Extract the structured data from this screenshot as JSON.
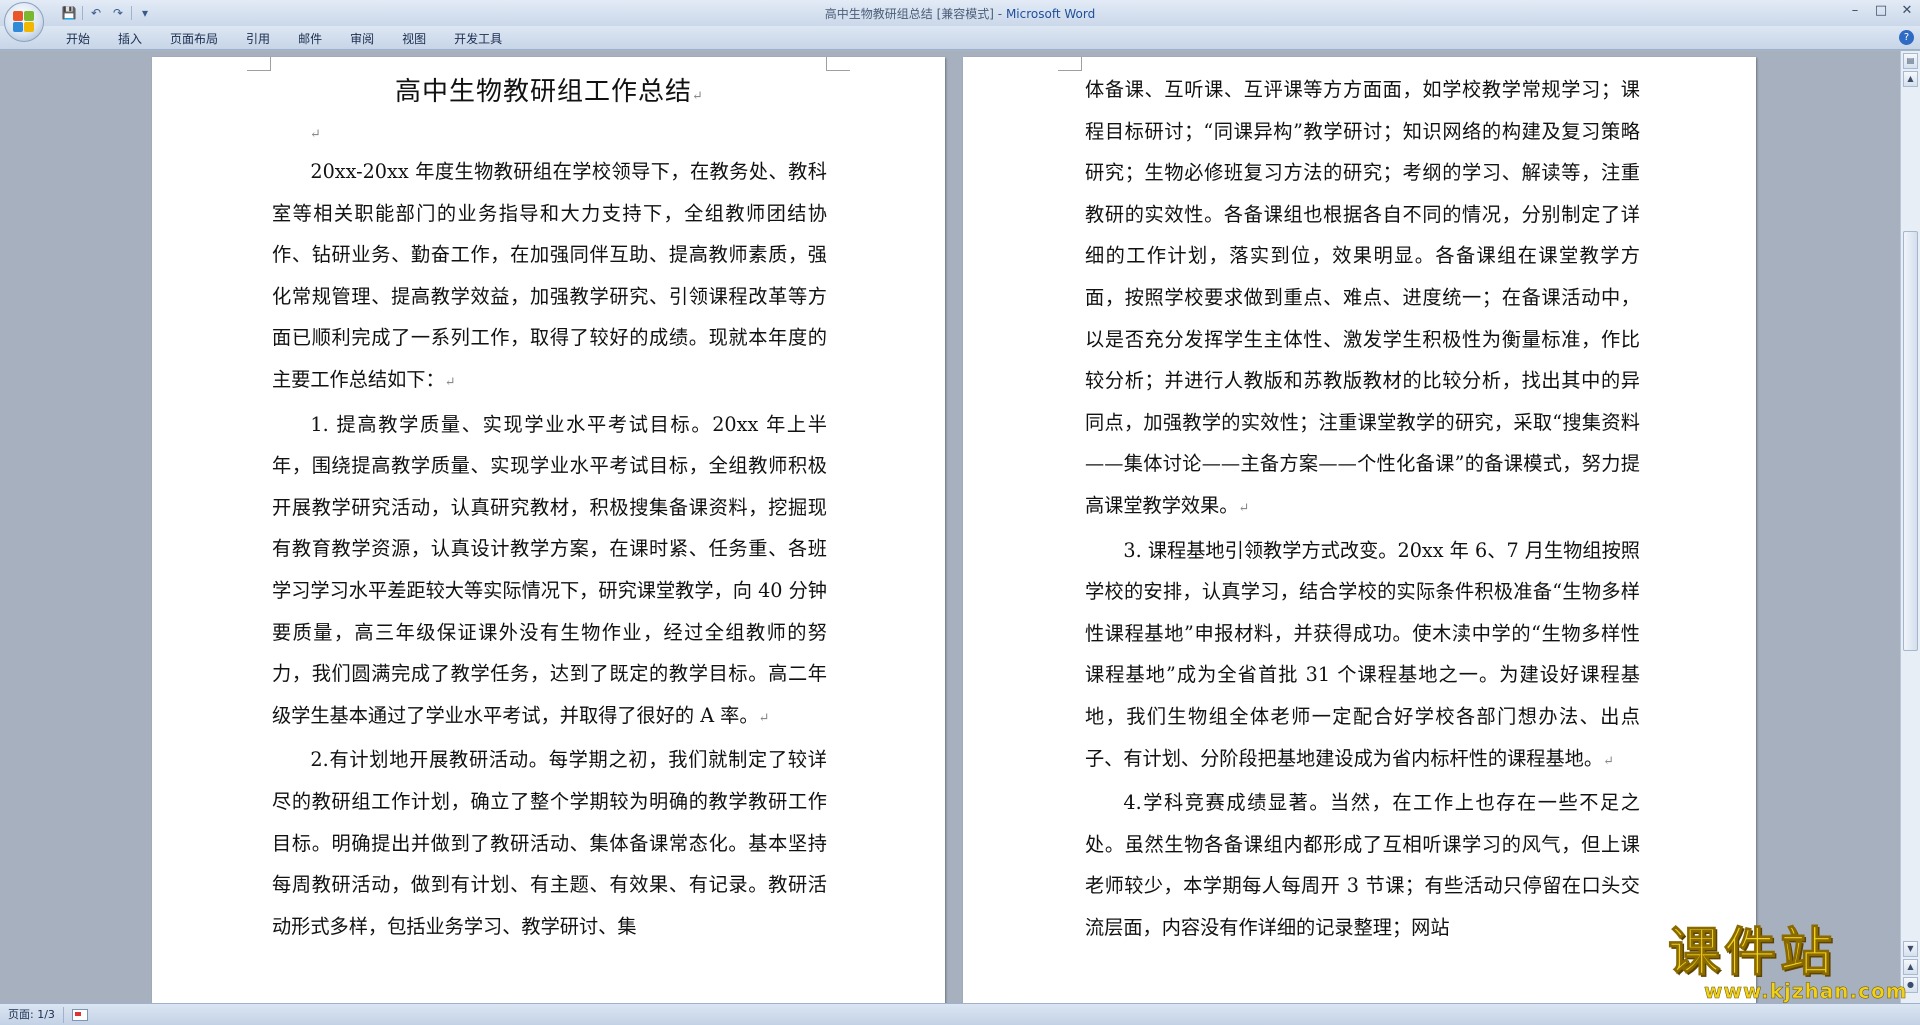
{
  "window": {
    "title": "高中生物教研组总结 [兼容模式]",
    "app_name": "Microsoft Word",
    "separator": " - ",
    "controls": {
      "minimize": "–",
      "maximize": "□",
      "close": "✕"
    }
  },
  "quick_access": {
    "save_icon": "💾",
    "undo_icon": "↶",
    "redo_icon": "↷",
    "customize_icon": "▾"
  },
  "ribbon": {
    "tabs": [
      "开始",
      "插入",
      "页面布局",
      "引用",
      "邮件",
      "审阅",
      "视图",
      "开发工具"
    ],
    "help_label": "?"
  },
  "document": {
    "page1": {
      "title": "高中生物教研组工作总结",
      "paragraphs": [
        "20xx-20xx 年度生物教研组在学校领导下，在教务处、教科室等相关职能部门的业务指导和大力支持下，全组教师团结协作、钻研业务、勤奋工作，在加强同伴互助、提高教师素质，强化常规管理、提高教学效益，加强教学研究、引领课程改革等方面已顺利完成了一系列工作，取得了较好的成绩。现就本年度的主要工作总结如下：",
        "1.  提高教学质量、实现学业水平考试目标。20xx 年上半年，围绕提高教学质量、实现学业水平考试目标，全组教师积极开展教学研究活动，认真研究教材，积极搜集备课资料，挖掘现有教育教学资源，认真设计教学方案，在课时紧、任务重、各班学习学习水平差距较大等实际情况下，研究课堂教学，向 40 分钟要质量，高三年级保证课外没有生物作业，经过全组教师的努力，我们圆满完成了教学任务，达到了既定的教学目标。高二年级学生基本通过了学业水平考试，并取得了很好的 A 率。",
        "2.有计划地开展教研活动。每学期之初，我们就制定了较详尽的教研组工作计划，确立了整个学期较为明确的教学教研工作目标。明确提出并做到了教研活动、集体备课常态化。基本坚持每周教研活动，做到有计划、有主题、有效果、有记录。教研活动形式多样，包括业务学习、教学研讨、集"
      ]
    },
    "page2": {
      "paragraphs": [
        "体备课、互听课、互评课等方方面面，如学校教学常规学习；课程目标研讨；“同课异构”教学研讨；知识网络的构建及复习策略研究；生物必修班复习方法的研究；考纲的学习、解读等，注重教研的实效性。各备课组也根据各自不同的情况，分别制定了详细的工作计划，落实到位，效果明显。各备课组在课堂教学方面，按照学校要求做到重点、难点、进度统一；在备课活动中，以是否充分发挥学生主体性、激发学生积极性为衡量标准，作比较分析；并进行人教版和苏教版教材的比较分析，找出其中的异同点，加强教学的实效性；注重课堂教学的研究，采取“搜集资料——集体讨论——主备方案——个性化备课”的备课模式，努力提高课堂教学效果。",
        "3.  课程基地引领教学方式改变。20xx 年 6、7 月生物组按照学校的安排，认真学习，结合学校的实际条件积极准备“生物多样性课程基地”申报材料，并获得成功。使木渎中学的“生物多样性课程基地”成为全省首批 31 个课程基地之一。为建设好课程基地，我们生物组全体老师一定配合好学校各部门想办法、出点子、有计划、分阶段把基地建设成为省内标杆性的课程基地。",
        "4.学科竞赛成绩显著。当然，在工作上也存在一些不足之处。虽然生物各备课组内都形成了互相听课学习的风气，但上课老师较少，本学期每人每周开 3 节课；有些活动只停留在口头交流层面，内容没有作详细的记录整理；网站"
      ]
    },
    "paragraph_mark": "↵"
  },
  "statusbar": {
    "page_info": "页面: 1/3"
  },
  "watermark": {
    "text": "课件站",
    "url": "www.kjzhan.com"
  }
}
